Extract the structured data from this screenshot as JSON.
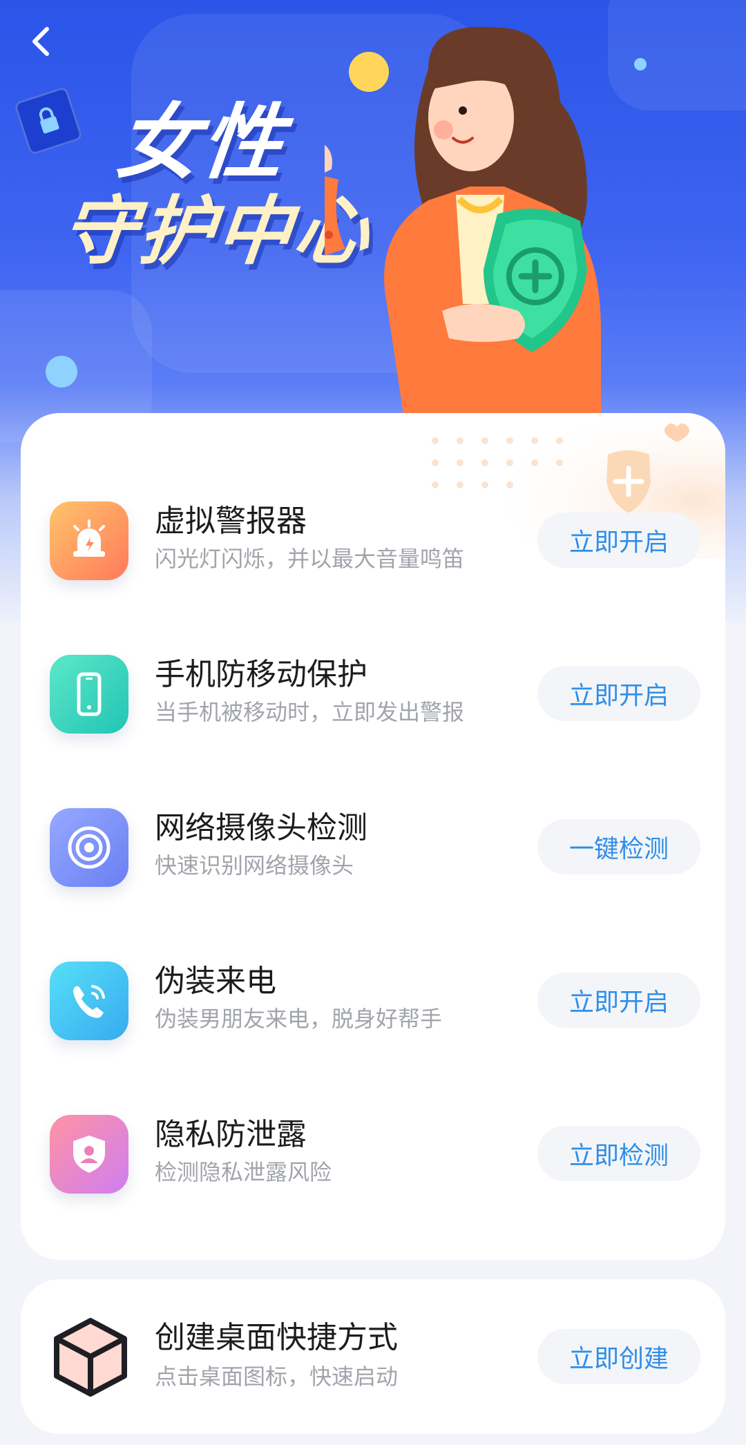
{
  "hero": {
    "title_line1": "女性",
    "title_line2": "守护中心"
  },
  "nav": {
    "back_icon": "chevron-left-icon"
  },
  "features": [
    {
      "id": "virtual-siren",
      "title": "虚拟警报器",
      "desc": "闪光灯闪烁，并以最大音量鸣笛",
      "button": "立即开启",
      "icon": "siren-icon",
      "colors": [
        "#ffb15a",
        "#ff7a5c"
      ]
    },
    {
      "id": "anti-move",
      "title": "手机防移动保护",
      "desc": "当手机被移动时，立即发出警报",
      "button": "立即开启",
      "icon": "phone-icon",
      "colors": [
        "#53e4c6",
        "#23c7b6"
      ]
    },
    {
      "id": "camera-detect",
      "title": "网络摄像头检测",
      "desc": "快速识别网络摄像头",
      "button": "一键检测",
      "icon": "camera-icon",
      "colors": [
        "#8ea3ff",
        "#6d82f5"
      ]
    },
    {
      "id": "fake-call",
      "title": "伪装来电",
      "desc": "伪装男朋友来电，脱身好帮手",
      "button": "立即开启",
      "icon": "phone-call-icon",
      "colors": [
        "#4fd6f5",
        "#3ab3f0"
      ]
    },
    {
      "id": "privacy-leak",
      "title": "隐私防泄露",
      "desc": "检测隐私泄露风险",
      "button": "立即检测",
      "icon": "shield-user-icon",
      "colors": [
        "#ff8fa7",
        "#d47ef0"
      ]
    }
  ],
  "shortcut": {
    "title": "创建桌面快捷方式",
    "desc": "点击桌面图标，快速启动",
    "button": "立即创建",
    "icon": "cube-icon"
  },
  "colors": {
    "accent": "#2f8ee8",
    "hero_blue": "#2a55e8",
    "button_bg": "#f3f5f8"
  }
}
